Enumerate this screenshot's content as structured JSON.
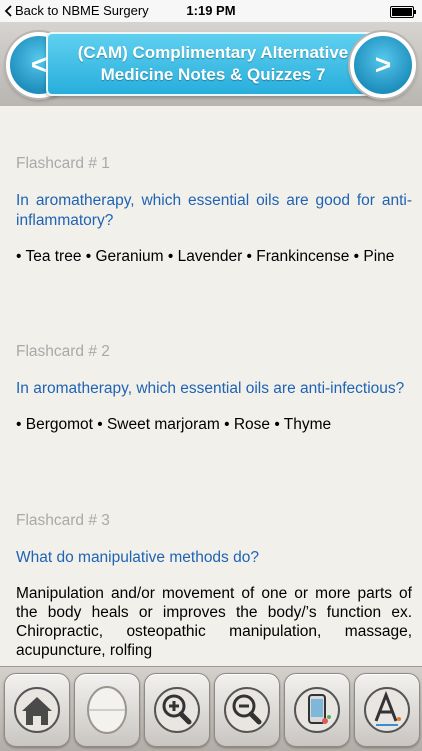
{
  "status_bar": {
    "back_label": "Back to NBME Surgery",
    "time": "1:19 PM"
  },
  "header": {
    "title_line1": "(CAM) Complimentary Alternative",
    "title_line2": "Medicine Notes & Quizzes 7",
    "prev_label": "<",
    "next_label": ">",
    "accent_color": "#2aaede"
  },
  "flashcards": [
    {
      "number": "Flashcard # 1",
      "question": "In aromatherapy, which essential oils are good for anti-inflammatory?",
      "answer": "• Tea tree • Geranium • Lavender • Frankincense • Pine"
    },
    {
      "number": "Flashcard # 2",
      "question": "In aromatherapy, which essential oils are anti-infectious?",
      "answer": "• Bergomot • Sweet marjoram • Rose • Thyme"
    },
    {
      "number": "Flashcard # 3",
      "question": "What do manipulative methods do?",
      "answer": "Manipulation and/or movement of one or more parts of the body heals or improves the body/’s function ex. Chiropractic, osteopathic manipulation, massage, acupuncture, rolfing"
    }
  ],
  "toolbar": {
    "icons": [
      "home-icon",
      "blank-card-icon",
      "zoom-in-icon",
      "zoom-out-icon",
      "phone-settings-icon",
      "font-size-icon"
    ]
  }
}
